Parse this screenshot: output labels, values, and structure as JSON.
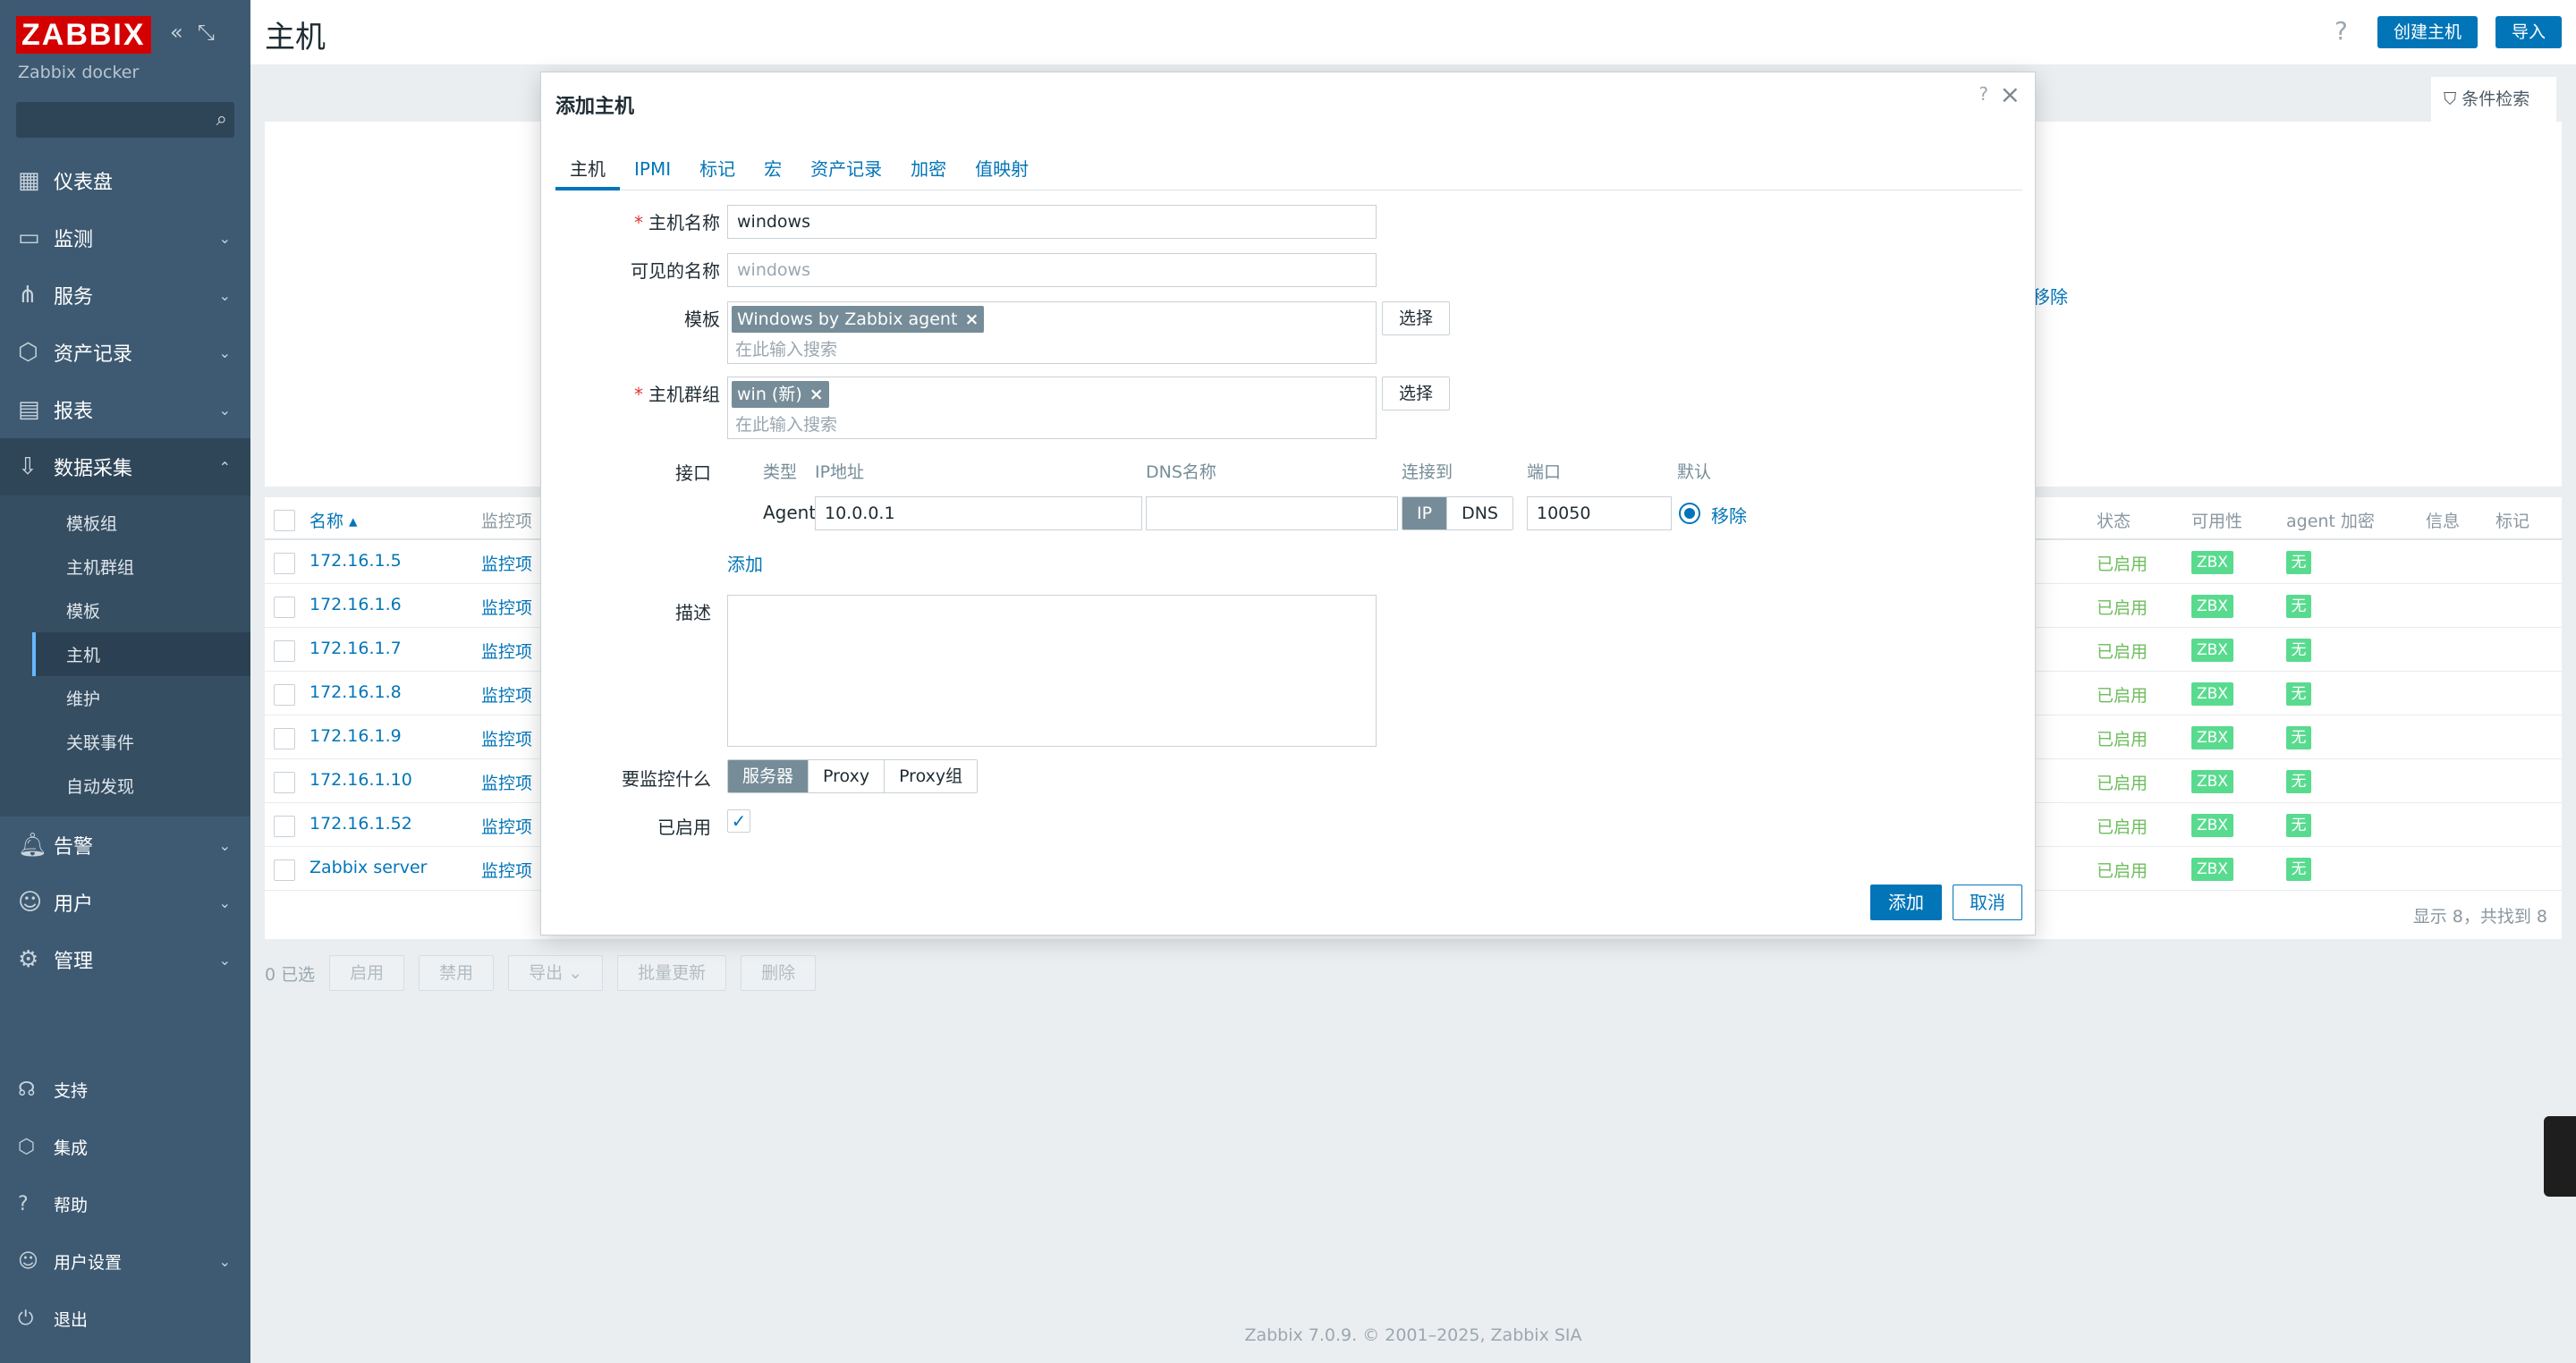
{
  "sidebar": {
    "logo": "ZABBIX",
    "subtitle": "Zabbix docker",
    "search_placeholder": "",
    "items": [
      {
        "label": "仪表盘",
        "icon": "dashboard-icon"
      },
      {
        "label": "监测",
        "icon": "monitoring-icon"
      },
      {
        "label": "服务",
        "icon": "services-icon"
      },
      {
        "label": "资产记录",
        "icon": "inventory-icon"
      },
      {
        "label": "报表",
        "icon": "reports-icon"
      },
      {
        "label": "数据采集",
        "icon": "data-collection-icon"
      },
      {
        "label": "告警",
        "icon": "alerts-icon"
      },
      {
        "label": "用户",
        "icon": "users-icon"
      },
      {
        "label": "管理",
        "icon": "administration-icon"
      }
    ],
    "subitems": [
      "模板组",
      "主机群组",
      "模板",
      "主机",
      "维护",
      "关联事件",
      "自动发现"
    ],
    "active_subitem": "主机",
    "bottom": [
      {
        "label": "支持",
        "icon": "headset-icon"
      },
      {
        "label": "集成",
        "icon": "integrations-icon"
      },
      {
        "label": "帮助",
        "icon": "help-icon"
      },
      {
        "label": "用户设置",
        "icon": "user-settings-icon"
      },
      {
        "label": "退出",
        "icon": "power-icon"
      }
    ]
  },
  "header": {
    "title": "主机",
    "create_button": "创建主机",
    "import_button": "导入",
    "filter_label": "条件检索"
  },
  "bg_remove_text": "移除",
  "hosts_table": {
    "columns": [
      "名称 ▴",
      "监控项",
      "状态",
      "可用性",
      "agent 加密",
      "信息",
      "标记"
    ],
    "rows": [
      {
        "name": "172.16.1.5",
        "items": "监控项",
        "status": "已启用",
        "availability": "ZBX",
        "encryption": "无"
      },
      {
        "name": "172.16.1.6",
        "items": "监控项",
        "status": "已启用",
        "availability": "ZBX",
        "encryption": "无"
      },
      {
        "name": "172.16.1.7",
        "items": "监控项",
        "status": "已启用",
        "availability": "ZBX",
        "encryption": "无"
      },
      {
        "name": "172.16.1.8",
        "items": "监控项",
        "status": "已启用",
        "availability": "ZBX",
        "encryption": "无"
      },
      {
        "name": "172.16.1.9",
        "items": "监控项",
        "status": "已启用",
        "availability": "ZBX",
        "encryption": "无"
      },
      {
        "name": "172.16.1.10",
        "items": "监控项",
        "status": "已启用",
        "availability": "ZBX",
        "encryption": "无"
      },
      {
        "name": "172.16.1.52",
        "items": "监控项",
        "status": "已启用",
        "availability": "ZBX",
        "encryption": "无"
      },
      {
        "name": "Zabbix server",
        "items": "监控项",
        "status": "已启用",
        "availability": "ZBX",
        "encryption": "无"
      }
    ],
    "footer": "显示 8，共找到 8"
  },
  "bulk": {
    "selected": "0 已选",
    "buttons": [
      "启用",
      "禁用",
      "导出",
      "批量更新",
      "删除"
    ]
  },
  "footer": "Zabbix 7.0.9. © 2001–2025, Zabbix SIA",
  "dialog": {
    "title": "添加主机",
    "tabs": [
      "主机",
      "IPMI",
      "标记",
      "宏",
      "资产记录",
      "加密",
      "值映射"
    ],
    "host_name_label": "主机名称",
    "host_name_value": "windows",
    "visible_name_label": "可见的名称",
    "visible_name_placeholder": "windows",
    "templates_label": "模板",
    "template_chip": "Windows by Zabbix agent",
    "groups_label": "主机群组",
    "group_chip": "win (新)",
    "search_placeholder": "在此输入搜索",
    "select_button": "选择",
    "interfaces_label": "接口",
    "iface_headers": {
      "type": "类型",
      "ip": "IP地址",
      "dns": "DNS名称",
      "connect": "连接到",
      "port": "端口",
      "default": "默认"
    },
    "interface": {
      "type": "Agent",
      "ip": "10.0.0.1",
      "dns": "",
      "connect_ip": "IP",
      "connect_dns": "DNS",
      "port": "10050",
      "remove": "移除"
    },
    "add_link": "添加",
    "description_label": "描述",
    "monitored_by_label": "要监控什么",
    "monitored_by_options": [
      "服务器",
      "Proxy",
      "Proxy组"
    ],
    "enabled_label": "已启用",
    "add_button": "添加",
    "cancel_button": "取消"
  }
}
